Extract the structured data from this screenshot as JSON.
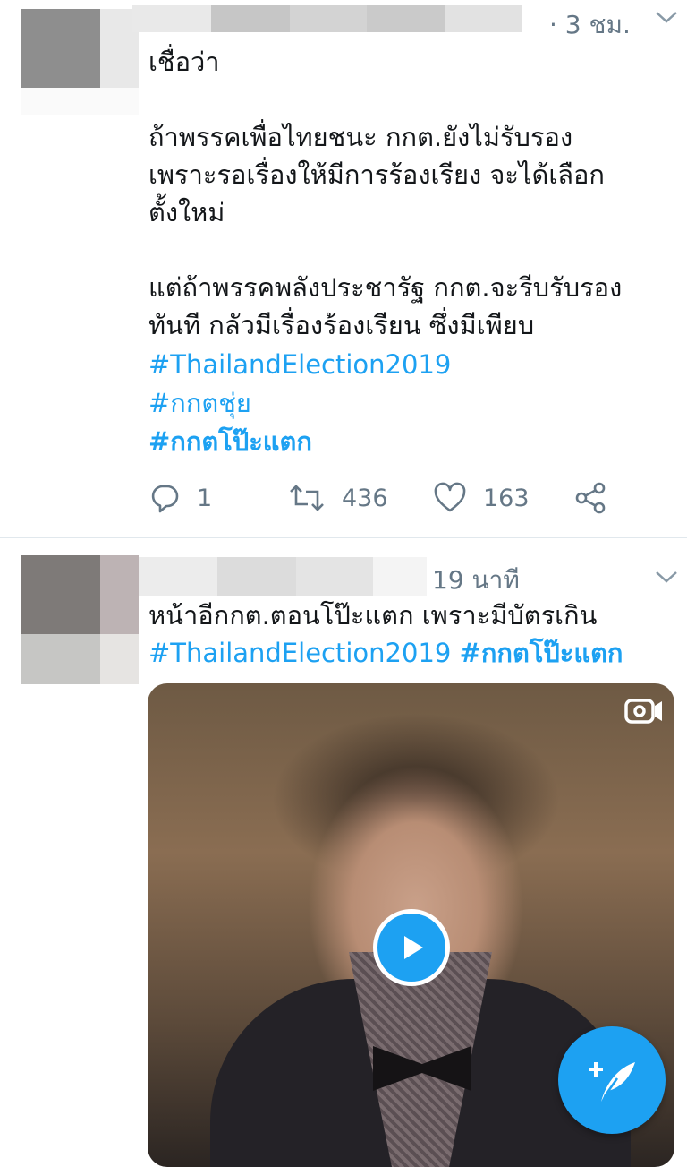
{
  "tweets": [
    {
      "time": "· 3 ชม.",
      "lines": [
        "เชื่อว่า",
        "",
        "ถ้าพรรคเพื่อไทยชนะ  กกต.ยังไม่รับรอง",
        "เพราะรอเรื่องให้มีการร้องเรียง  จะได้เลือก",
        "ตั้งใหม่",
        "",
        "แต่ถ้าพรรคพลังประชารัฐ  กกต.จะรีบรับรอง",
        "ทันที  กลัวมีเรื่องร้องเรียน ซึ่งมีเพียบ"
      ],
      "hashtags": [
        "#ThailandElection2019",
        "#กกตชุ่ย",
        "#กกตโป๊ะแตก"
      ],
      "replies": "1",
      "retweets": "436",
      "likes": "163"
    },
    {
      "time": "19 นาที",
      "text": "หน้าอีกกต.ตอนโป๊ะแตก เพราะมีบัตรเกิน",
      "hashtag1": "#ThailandElection2019",
      "hashtag2": "#กกตโป๊ะแตก",
      "media_type": "video"
    }
  ],
  "icons": {
    "reply": "reply-icon",
    "retweet": "retweet-icon",
    "like": "heart-icon",
    "share": "share-icon",
    "more": "chevron-down-icon",
    "compose": "compose-tweet-icon"
  },
  "colors": {
    "link": "#1da1f2",
    "secondary_text": "#657786",
    "divider": "#e1e8ed"
  }
}
